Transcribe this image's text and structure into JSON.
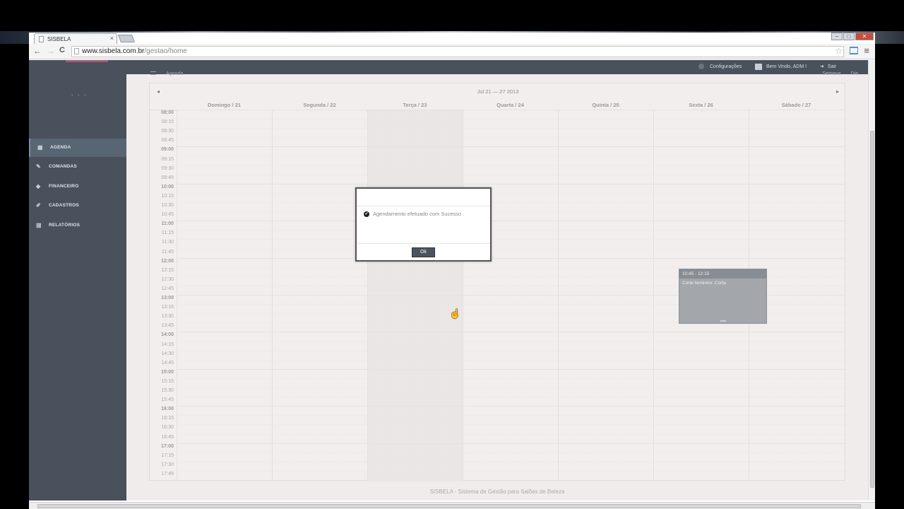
{
  "browser": {
    "tab_title": "SISBELA",
    "tab_close": "×",
    "url_domain": "www.sisbela.com.br",
    "url_path": "/gestao/home",
    "back_glyph": "←",
    "forward_glyph": "→",
    "reload_glyph": "C",
    "star_glyph": "☆",
    "menu_glyph": "≡",
    "win_min": "–",
    "win_max": "□",
    "win_close": "✕"
  },
  "topbar": {
    "settings": "Configurações",
    "welcome": "Bem Vindo, ADM !",
    "logout": "Sair",
    "logout_glyph": "➜"
  },
  "sidebar": {
    "dots": "• • •",
    "items": [
      {
        "label": "AGENDA",
        "icon": "calendar-icon",
        "glyph": "▦"
      },
      {
        "label": "COMANDAS",
        "icon": "edit-icon",
        "glyph": "✎"
      },
      {
        "label": "FINANCEIRO",
        "icon": "tag-icon",
        "glyph": "◆"
      },
      {
        "label": "CADASTROS",
        "icon": "pencil-icon",
        "glyph": "✐"
      },
      {
        "label": "RELATÓRIOS",
        "icon": "bar-chart-icon",
        "glyph": "▥"
      }
    ]
  },
  "calendar": {
    "header_label": "Agenda",
    "view_week": "Semana",
    "view_day": "Dia",
    "range": "Jul 21 — 27 2013",
    "prev_glyph": "◂",
    "next_glyph": "▸",
    "days": [
      "Domingo / 21",
      "Segunda / 22",
      "Terça / 23",
      "Quarta / 24",
      "Quinta / 25",
      "Sexta / 26",
      "Sábado / 27"
    ],
    "times": [
      "08:00",
      "08:15",
      "08:30",
      "08:45",
      "09:00",
      "09:15",
      "09:30",
      "09:45",
      "10:00",
      "10:15",
      "10:30",
      "10:45",
      "11:00",
      "11:15",
      "11:30",
      "11:45",
      "12:00",
      "12:15",
      "12:30",
      "12:45",
      "13:00",
      "13:15",
      "13:30",
      "13:45",
      "14:00",
      "14:15",
      "14:30",
      "14:45",
      "15:00",
      "15:15",
      "15:30",
      "15:45",
      "16:00",
      "16:15",
      "16:30",
      "16:45",
      "17:00",
      "17:15",
      "17:30",
      "17:45"
    ],
    "event": {
      "time": "10:45 - 12:15",
      "title": "Corte feminino: Corta"
    }
  },
  "modal": {
    "message": "Agendamento efetuado com Sucesso",
    "check_glyph": "✔",
    "ok": "Ok"
  },
  "footer": "SISBELA - Sistema de Gestão para Salões de Beleza"
}
